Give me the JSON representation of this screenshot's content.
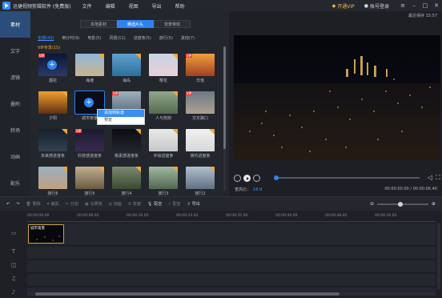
{
  "app": {
    "title": "迅捷视频剪辑软件 (免费版)",
    "menu": [
      "文件",
      "编辑",
      "视图",
      "导出",
      "帮助"
    ],
    "vip_label": "开通VIP",
    "login_label": "账号登录"
  },
  "sidebar": {
    "items": [
      {
        "label": "素材"
      },
      {
        "label": "文字"
      },
      {
        "label": "滤镜"
      },
      {
        "label": "叠附"
      },
      {
        "label": "转场"
      },
      {
        "label": "动画"
      },
      {
        "label": "配乐"
      }
    ]
  },
  "library": {
    "tabs": [
      "本地素材",
      "精选片头",
      "背景特效"
    ],
    "categories": [
      "全部(43)",
      "倒计时(9)",
      "电影(5)",
      "风景(11)",
      "进度条(5)",
      "旅行(5)",
      "其他(7)"
    ],
    "section_title": "VIP专享(15)",
    "tiles": [
      {
        "label": "烟花"
      },
      {
        "label": "海滩"
      },
      {
        "label": "海岛"
      },
      {
        "label": "樱花"
      },
      {
        "label": "日落"
      },
      {
        "label": "夕阳"
      },
      {
        "label": "城市夜景"
      },
      {
        "label": ""
      },
      {
        "label": "人与狗狗"
      },
      {
        "label": "交叉路口"
      },
      {
        "label": "未来感进度条"
      },
      {
        "label": "科技感进度条"
      },
      {
        "label": "像素感进度条"
      },
      {
        "label": "手绘进度条"
      },
      {
        "label": "简约进度条"
      },
      {
        "label": "旅行6"
      },
      {
        "label": "旅行5"
      },
      {
        "label": "旅行4"
      },
      {
        "label": "旅行3"
      },
      {
        "label": "旅行2"
      }
    ],
    "vip_badge": "VIP",
    "context_menu": [
      "添加到轨道",
      "预览"
    ]
  },
  "preview": {
    "fullscreen_label": "最近保存 15:57",
    "ratio_label": "宽高比：",
    "ratio_value": "16:9",
    "timecode": "00:00:00.00 / 00:00:06.40",
    "progress": 0.0
  },
  "timeline_toolbar": {
    "tools": [
      "撤销",
      "重做",
      "删除",
      "裁剪",
      "分割",
      "马赛克",
      "配音",
      "动画",
      "变速",
      "配音",
      "导出"
    ],
    "record_label": "配音",
    "export_label": "导出",
    "zoom_level": 0.45
  },
  "timeline": {
    "ruler": [
      "00:00:00.00",
      "00:00:08.00",
      "00:00:16.00",
      "00:00:24.00",
      "00:00:32.00",
      "00:00:40.00",
      "00:00:48.00",
      "00:00:56.00",
      "00:01:04.00"
    ],
    "clip_label": "城市夜景",
    "track_icons": [
      "video-track-icon",
      "text-track-icon",
      "overlay-track-icon",
      "music-track-icon",
      "audio-track-icon"
    ]
  }
}
